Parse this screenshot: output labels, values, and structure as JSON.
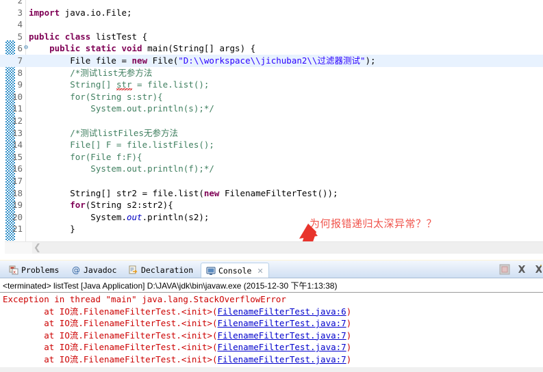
{
  "editor": {
    "lines": [
      {
        "num": "2",
        "segments": []
      },
      {
        "num": "3",
        "segments": [
          {
            "t": "import",
            "c": "kw"
          },
          {
            "t": " java.io.File;",
            "c": "plain"
          }
        ]
      },
      {
        "num": "4",
        "segments": []
      },
      {
        "num": "5",
        "segments": [
          {
            "t": "public",
            "c": "kw"
          },
          {
            "t": " ",
            "c": "plain"
          },
          {
            "t": "class",
            "c": "kw"
          },
          {
            "t": " listTest {",
            "c": "plain"
          }
        ]
      },
      {
        "num": "6",
        "fold": true,
        "segments": [
          {
            "t": "    ",
            "c": "plain"
          },
          {
            "t": "public",
            "c": "kw"
          },
          {
            "t": " ",
            "c": "plain"
          },
          {
            "t": "static",
            "c": "kw"
          },
          {
            "t": " ",
            "c": "plain"
          },
          {
            "t": "void",
            "c": "kw"
          },
          {
            "t": " main(String[] args) {",
            "c": "plain"
          }
        ]
      },
      {
        "num": "7",
        "current": true,
        "segments": [
          {
            "t": "        File file = ",
            "c": "plain"
          },
          {
            "t": "new",
            "c": "kw"
          },
          {
            "t": " File(",
            "c": "plain"
          },
          {
            "t": "\"D:\\\\workspace\\\\jichuban2\\\\过滤器测试\"",
            "c": "str"
          },
          {
            "t": ");",
            "c": "plain"
          }
        ]
      },
      {
        "num": "8",
        "segments": [
          {
            "t": "        /*测试list无参方法",
            "c": "cmt"
          }
        ]
      },
      {
        "num": "9",
        "segments": [
          {
            "t": "        String[] ",
            "c": "cmt"
          },
          {
            "t": "str",
            "c": "cmt squig"
          },
          {
            "t": " = file.list();",
            "c": "cmt"
          }
        ]
      },
      {
        "num": "10",
        "segments": [
          {
            "t": "        for(String s:str){",
            "c": "cmt"
          }
        ]
      },
      {
        "num": "11",
        "segments": [
          {
            "t": "            System.out.println(s);*/",
            "c": "cmt"
          }
        ]
      },
      {
        "num": "12",
        "segments": []
      },
      {
        "num": "13",
        "segments": [
          {
            "t": "        /*测试listFiles无参方法",
            "c": "cmt"
          }
        ]
      },
      {
        "num": "14",
        "segments": [
          {
            "t": "        File[] F = file.listFiles();",
            "c": "cmt"
          }
        ]
      },
      {
        "num": "15",
        "segments": [
          {
            "t": "        for(File f:F){",
            "c": "cmt"
          }
        ]
      },
      {
        "num": "16",
        "segments": [
          {
            "t": "            System.out.println(f);*/",
            "c": "cmt"
          }
        ]
      },
      {
        "num": "17",
        "segments": []
      },
      {
        "num": "18",
        "segments": [
          {
            "t": "        String[] str2 = file.list(",
            "c": "plain"
          },
          {
            "t": "new",
            "c": "kw"
          },
          {
            "t": " FilenameFilterTest());",
            "c": "plain"
          }
        ]
      },
      {
        "num": "19",
        "segments": [
          {
            "t": "        ",
            "c": "plain"
          },
          {
            "t": "for",
            "c": "kw"
          },
          {
            "t": "(String s2:str2){",
            "c": "plain"
          }
        ]
      },
      {
        "num": "20",
        "segments": [
          {
            "t": "            System.",
            "c": "plain"
          },
          {
            "t": "out",
            "c": "fld"
          },
          {
            "t": ".println(s2);",
            "c": "plain"
          }
        ]
      },
      {
        "num": "21",
        "segments": [
          {
            "t": "        }",
            "c": "plain"
          }
        ]
      }
    ],
    "annotation": "为何报错递归太深异常？？",
    "annotation_color": "#f0544c",
    "arrow_color": "#e8342c",
    "scroll_left_icon": "chevron-left-icon"
  },
  "console": {
    "tabs": [
      {
        "label": "Problems",
        "icon": "problems-icon",
        "active": false,
        "closable": false
      },
      {
        "label": "Javadoc",
        "icon": "javadoc-at-icon",
        "active": false,
        "closable": false
      },
      {
        "label": "Declaration",
        "icon": "declaration-icon",
        "active": false,
        "closable": false
      },
      {
        "label": "Console",
        "icon": "console-icon",
        "active": true,
        "closable": true,
        "close_glyph": "✕"
      }
    ],
    "toolbar": [
      {
        "name": "terminate-button",
        "glyph": "stop-square-icon"
      },
      {
        "name": "remove-launch-button",
        "glyph": "x-remove-icon"
      },
      {
        "name": "remove-all-button",
        "glyph": "x-remove-all-icon"
      }
    ],
    "terminated_line": "<terminated> listTest [Java Application] D:\\JAVA\\jdk\\bin\\javaw.exe (2015-12-30 下午1:13:38)",
    "exception_line": "Exception in thread \"main\" java.lang.StackOverflowError",
    "stack_frames": [
      {
        "prefix": "\tat IO流.FilenameFilterTest.<init>(",
        "link": "FilenameFilterTest.java:6",
        "suffix": ")"
      },
      {
        "prefix": "\tat IO流.FilenameFilterTest.<init>(",
        "link": "FilenameFilterTest.java:7",
        "suffix": ")"
      },
      {
        "prefix": "\tat IO流.FilenameFilterTest.<init>(",
        "link": "FilenameFilterTest.java:7",
        "suffix": ")"
      },
      {
        "prefix": "\tat IO流.FilenameFilterTest.<init>(",
        "link": "FilenameFilterTest.java:7",
        "suffix": ")"
      },
      {
        "prefix": "\tat IO流.FilenameFilterTest.<init>(",
        "link": "FilenameFilterTest.java:7",
        "suffix": ")"
      }
    ],
    "error_color": "#cc0000",
    "link_color": "#0000cc"
  }
}
